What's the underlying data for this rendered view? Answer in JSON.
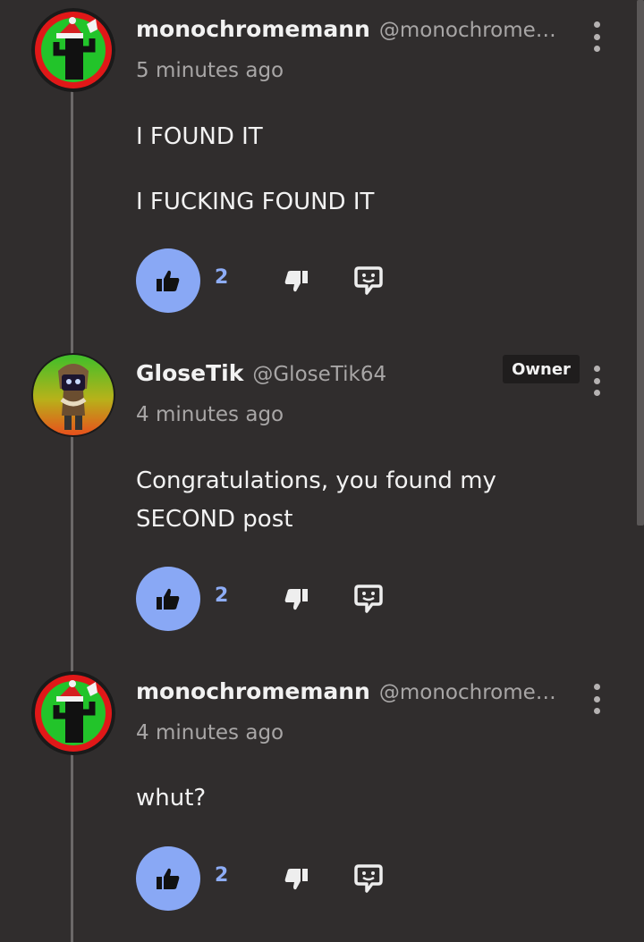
{
  "colors": {
    "background": "#302d2d",
    "like_button": "#89a8f5",
    "like_count": "#8eadf7",
    "owner_badge_bg": "#1f1d1d",
    "muted_text": "#a8a6a6"
  },
  "comments": [
    {
      "author": "monochromemann",
      "handle": "@monochrome…",
      "time": "5 minutes ago",
      "avatar_icon": "cactus-santa-hat-avatar",
      "body": [
        "I FOUND IT",
        "I FUCKING FOUND IT"
      ],
      "likes": "2",
      "badge": ""
    },
    {
      "author": "GloseTik",
      "handle": "@GloseTik64",
      "time": "4 minutes ago",
      "avatar_icon": "hooded-character-avatar",
      "body": [
        "Congratulations, you found my SECOND post"
      ],
      "likes": "2",
      "badge": "Owner"
    },
    {
      "author": "monochromemann",
      "handle": "@monochrome…",
      "time": "4 minutes ago",
      "avatar_icon": "cactus-santa-hat-avatar",
      "body": [
        "whut?"
      ],
      "likes": "2",
      "badge": ""
    }
  ],
  "icons": {
    "like": "thumbs-up-icon",
    "dislike": "thumbs-down-icon",
    "reply": "reply-speech-icon",
    "menu": "more-vertical-icon"
  }
}
